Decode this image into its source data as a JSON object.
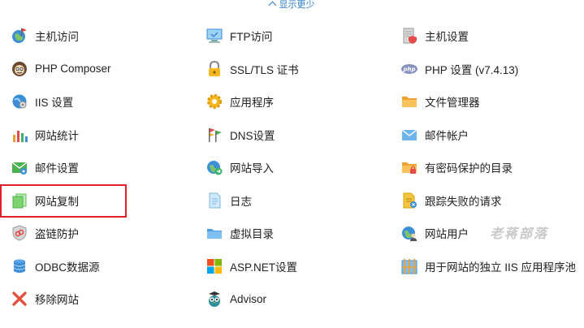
{
  "header": {
    "show_less_label": "显示更少"
  },
  "columns": [
    [
      {
        "label": "主机访问",
        "icon": "host-access-icon"
      },
      {
        "label": "PHP Composer",
        "icon": "composer-icon"
      },
      {
        "label": "IIS 设置",
        "icon": "iis-settings-icon"
      },
      {
        "label": "网站统计",
        "icon": "statistics-icon"
      },
      {
        "label": "邮件设置",
        "icon": "mail-settings-icon"
      },
      {
        "label": "网站复制",
        "icon": "website-copy-icon"
      },
      {
        "label": "盗链防护",
        "icon": "hotlink-protection-icon"
      },
      {
        "label": "ODBC数据源",
        "icon": "database-icon"
      },
      {
        "label": "移除网站",
        "icon": "remove-icon"
      }
    ],
    [
      {
        "label": "FTP访问",
        "icon": "ftp-icon"
      },
      {
        "label": "SSL/TLS 证书",
        "icon": "lock-icon"
      },
      {
        "label": "应用程序",
        "icon": "gear-icon"
      },
      {
        "label": "DNS设置",
        "icon": "dns-flags-icon"
      },
      {
        "label": "网站导入",
        "icon": "website-import-icon"
      },
      {
        "label": "日志",
        "icon": "log-icon"
      },
      {
        "label": "虚拟目录",
        "icon": "folder-icon"
      },
      {
        "label": "ASP.NET设置",
        "icon": "aspnet-icon"
      },
      {
        "label": "Advisor",
        "icon": "owl-icon"
      }
    ],
    [
      {
        "label": "主机设置",
        "icon": "host-settings-icon"
      },
      {
        "label": "PHP 设置 (v7.4.13)",
        "icon": "php-icon"
      },
      {
        "label": "文件管理器",
        "icon": "file-manager-icon"
      },
      {
        "label": "邮件帐户",
        "icon": "mail-account-icon"
      },
      {
        "label": "有密码保护的目录",
        "icon": "protected-folder-icon"
      },
      {
        "label": "跟踪失败的请求",
        "icon": "failed-requests-icon"
      },
      {
        "label": "网站用户",
        "icon": "web-users-icon"
      },
      {
        "label": "用于网站的独立 IIS 应用程序池",
        "icon": "app-pool-icon"
      }
    ]
  ],
  "watermark": "老蒋部落",
  "colors": {
    "accent": "#2b7bd3",
    "highlight": "#e0202a"
  }
}
